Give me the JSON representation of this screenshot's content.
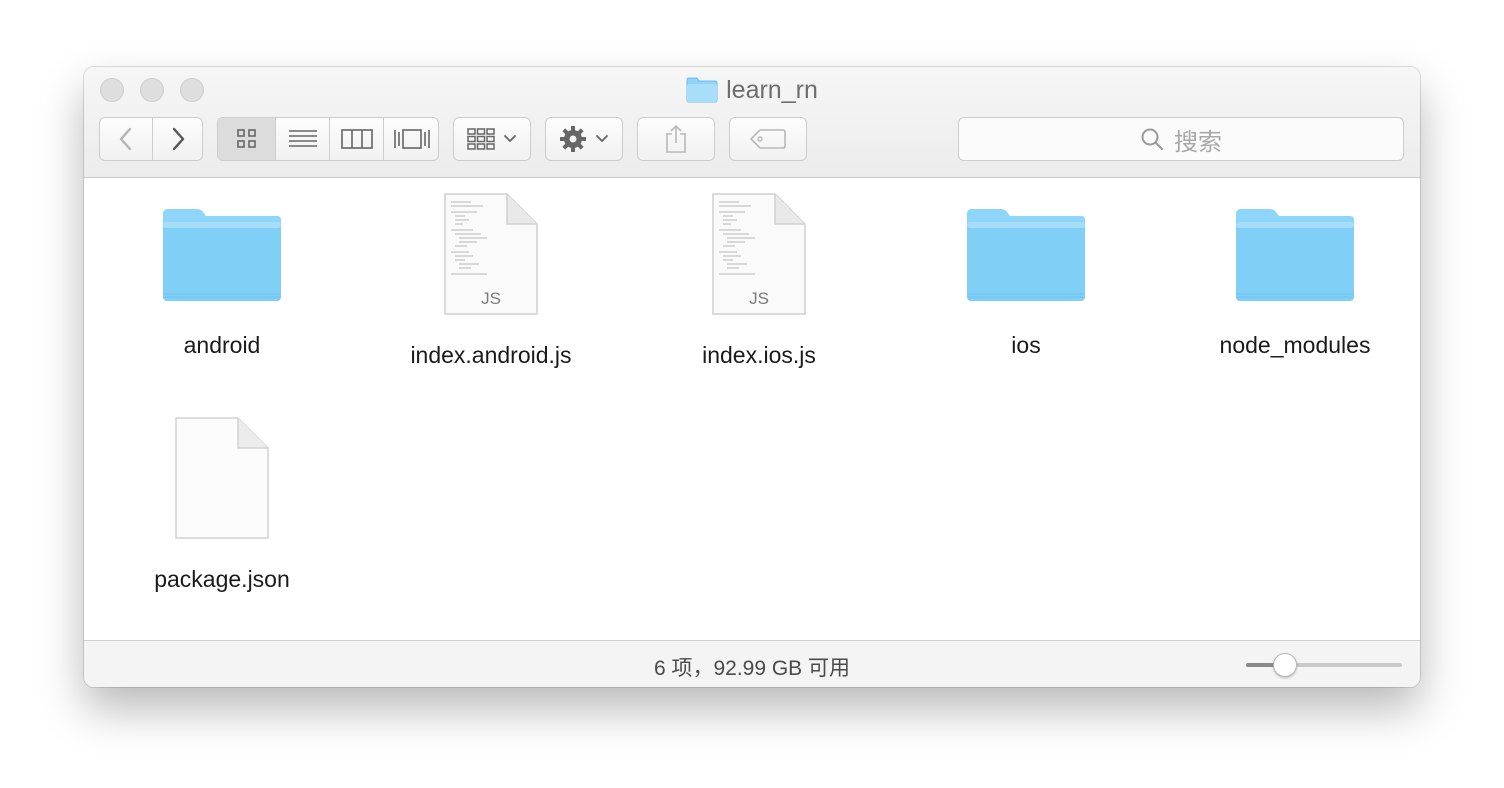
{
  "window": {
    "title": "learn_rn",
    "title_icon": "folder-icon"
  },
  "toolbar": {
    "back": "chevron-left-icon",
    "forward": "chevron-right-icon",
    "view_modes": [
      "icon-view-icon",
      "list-view-icon",
      "column-view-icon",
      "gallery-view-icon"
    ],
    "selected_view": "icon-view-icon",
    "group": "arrange-icon",
    "action": "gear-icon",
    "share": "share-icon",
    "tags": "tag-icon",
    "search_placeholder": "搜索"
  },
  "files": [
    {
      "name": "android",
      "kind": "folder"
    },
    {
      "name": "index.android.js",
      "kind": "js",
      "badge": "JS"
    },
    {
      "name": "index.ios.js",
      "kind": "js",
      "badge": "JS"
    },
    {
      "name": "ios",
      "kind": "folder"
    },
    {
      "name": "node_modules",
      "kind": "folder"
    },
    {
      "name": "package.json",
      "kind": "blank"
    }
  ],
  "status": {
    "text": "6 项，92.99 GB 可用"
  },
  "icon_size_slider": {
    "value": 0.25
  },
  "colors": {
    "folder_top": "#a6dcfb",
    "folder_body": "#7fcff6",
    "toolbar_bg": "#ececec"
  }
}
